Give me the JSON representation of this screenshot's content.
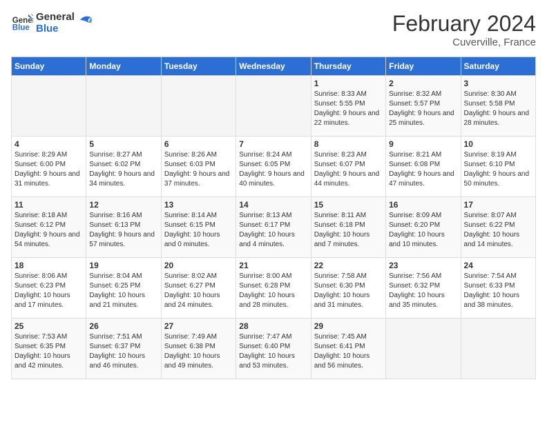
{
  "header": {
    "logo_line1": "General",
    "logo_line2": "Blue",
    "month_year": "February 2024",
    "location": "Cuverville, France"
  },
  "weekdays": [
    "Sunday",
    "Monday",
    "Tuesday",
    "Wednesday",
    "Thursday",
    "Friday",
    "Saturday"
  ],
  "weeks": [
    [
      {
        "day": "",
        "info": ""
      },
      {
        "day": "",
        "info": ""
      },
      {
        "day": "",
        "info": ""
      },
      {
        "day": "",
        "info": ""
      },
      {
        "day": "1",
        "info": "Sunrise: 8:33 AM\nSunset: 5:55 PM\nDaylight: 9 hours and 22 minutes."
      },
      {
        "day": "2",
        "info": "Sunrise: 8:32 AM\nSunset: 5:57 PM\nDaylight: 9 hours and 25 minutes."
      },
      {
        "day": "3",
        "info": "Sunrise: 8:30 AM\nSunset: 5:58 PM\nDaylight: 9 hours and 28 minutes."
      }
    ],
    [
      {
        "day": "4",
        "info": "Sunrise: 8:29 AM\nSunset: 6:00 PM\nDaylight: 9 hours and 31 minutes."
      },
      {
        "day": "5",
        "info": "Sunrise: 8:27 AM\nSunset: 6:02 PM\nDaylight: 9 hours and 34 minutes."
      },
      {
        "day": "6",
        "info": "Sunrise: 8:26 AM\nSunset: 6:03 PM\nDaylight: 9 hours and 37 minutes."
      },
      {
        "day": "7",
        "info": "Sunrise: 8:24 AM\nSunset: 6:05 PM\nDaylight: 9 hours and 40 minutes."
      },
      {
        "day": "8",
        "info": "Sunrise: 8:23 AM\nSunset: 6:07 PM\nDaylight: 9 hours and 44 minutes."
      },
      {
        "day": "9",
        "info": "Sunrise: 8:21 AM\nSunset: 6:08 PM\nDaylight: 9 hours and 47 minutes."
      },
      {
        "day": "10",
        "info": "Sunrise: 8:19 AM\nSunset: 6:10 PM\nDaylight: 9 hours and 50 minutes."
      }
    ],
    [
      {
        "day": "11",
        "info": "Sunrise: 8:18 AM\nSunset: 6:12 PM\nDaylight: 9 hours and 54 minutes."
      },
      {
        "day": "12",
        "info": "Sunrise: 8:16 AM\nSunset: 6:13 PM\nDaylight: 9 hours and 57 minutes."
      },
      {
        "day": "13",
        "info": "Sunrise: 8:14 AM\nSunset: 6:15 PM\nDaylight: 10 hours and 0 minutes."
      },
      {
        "day": "14",
        "info": "Sunrise: 8:13 AM\nSunset: 6:17 PM\nDaylight: 10 hours and 4 minutes."
      },
      {
        "day": "15",
        "info": "Sunrise: 8:11 AM\nSunset: 6:18 PM\nDaylight: 10 hours and 7 minutes."
      },
      {
        "day": "16",
        "info": "Sunrise: 8:09 AM\nSunset: 6:20 PM\nDaylight: 10 hours and 10 minutes."
      },
      {
        "day": "17",
        "info": "Sunrise: 8:07 AM\nSunset: 6:22 PM\nDaylight: 10 hours and 14 minutes."
      }
    ],
    [
      {
        "day": "18",
        "info": "Sunrise: 8:06 AM\nSunset: 6:23 PM\nDaylight: 10 hours and 17 minutes."
      },
      {
        "day": "19",
        "info": "Sunrise: 8:04 AM\nSunset: 6:25 PM\nDaylight: 10 hours and 21 minutes."
      },
      {
        "day": "20",
        "info": "Sunrise: 8:02 AM\nSunset: 6:27 PM\nDaylight: 10 hours and 24 minutes."
      },
      {
        "day": "21",
        "info": "Sunrise: 8:00 AM\nSunset: 6:28 PM\nDaylight: 10 hours and 28 minutes."
      },
      {
        "day": "22",
        "info": "Sunrise: 7:58 AM\nSunset: 6:30 PM\nDaylight: 10 hours and 31 minutes."
      },
      {
        "day": "23",
        "info": "Sunrise: 7:56 AM\nSunset: 6:32 PM\nDaylight: 10 hours and 35 minutes."
      },
      {
        "day": "24",
        "info": "Sunrise: 7:54 AM\nSunset: 6:33 PM\nDaylight: 10 hours and 38 minutes."
      }
    ],
    [
      {
        "day": "25",
        "info": "Sunrise: 7:53 AM\nSunset: 6:35 PM\nDaylight: 10 hours and 42 minutes."
      },
      {
        "day": "26",
        "info": "Sunrise: 7:51 AM\nSunset: 6:37 PM\nDaylight: 10 hours and 46 minutes."
      },
      {
        "day": "27",
        "info": "Sunrise: 7:49 AM\nSunset: 6:38 PM\nDaylight: 10 hours and 49 minutes."
      },
      {
        "day": "28",
        "info": "Sunrise: 7:47 AM\nSunset: 6:40 PM\nDaylight: 10 hours and 53 minutes."
      },
      {
        "day": "29",
        "info": "Sunrise: 7:45 AM\nSunset: 6:41 PM\nDaylight: 10 hours and 56 minutes."
      },
      {
        "day": "",
        "info": ""
      },
      {
        "day": "",
        "info": ""
      }
    ]
  ]
}
